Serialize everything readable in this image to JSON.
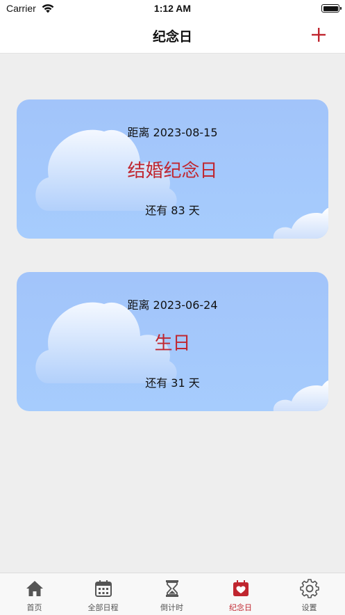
{
  "status_bar": {
    "carrier": "Carrier",
    "time": "1:12 AM"
  },
  "nav": {
    "title": "纪念日",
    "add_icon": "plus-icon"
  },
  "accent_color": "#c0262f",
  "cards": [
    {
      "date_line": "距离 2023-08-15",
      "title": "结婚纪念日",
      "remaining": "还有 83 天"
    },
    {
      "date_line": "距离 2023-06-24",
      "title": "生日",
      "remaining": "还有 31 天"
    }
  ],
  "tabs": [
    {
      "label": "首页",
      "icon": "home-icon",
      "active": false
    },
    {
      "label": "全部日程",
      "icon": "calendar-icon",
      "active": false
    },
    {
      "label": "倒计时",
      "icon": "hourglass-icon",
      "active": false
    },
    {
      "label": "纪念日",
      "icon": "calendar-heart-icon",
      "active": true
    },
    {
      "label": "设置",
      "icon": "gear-icon",
      "active": false
    }
  ]
}
